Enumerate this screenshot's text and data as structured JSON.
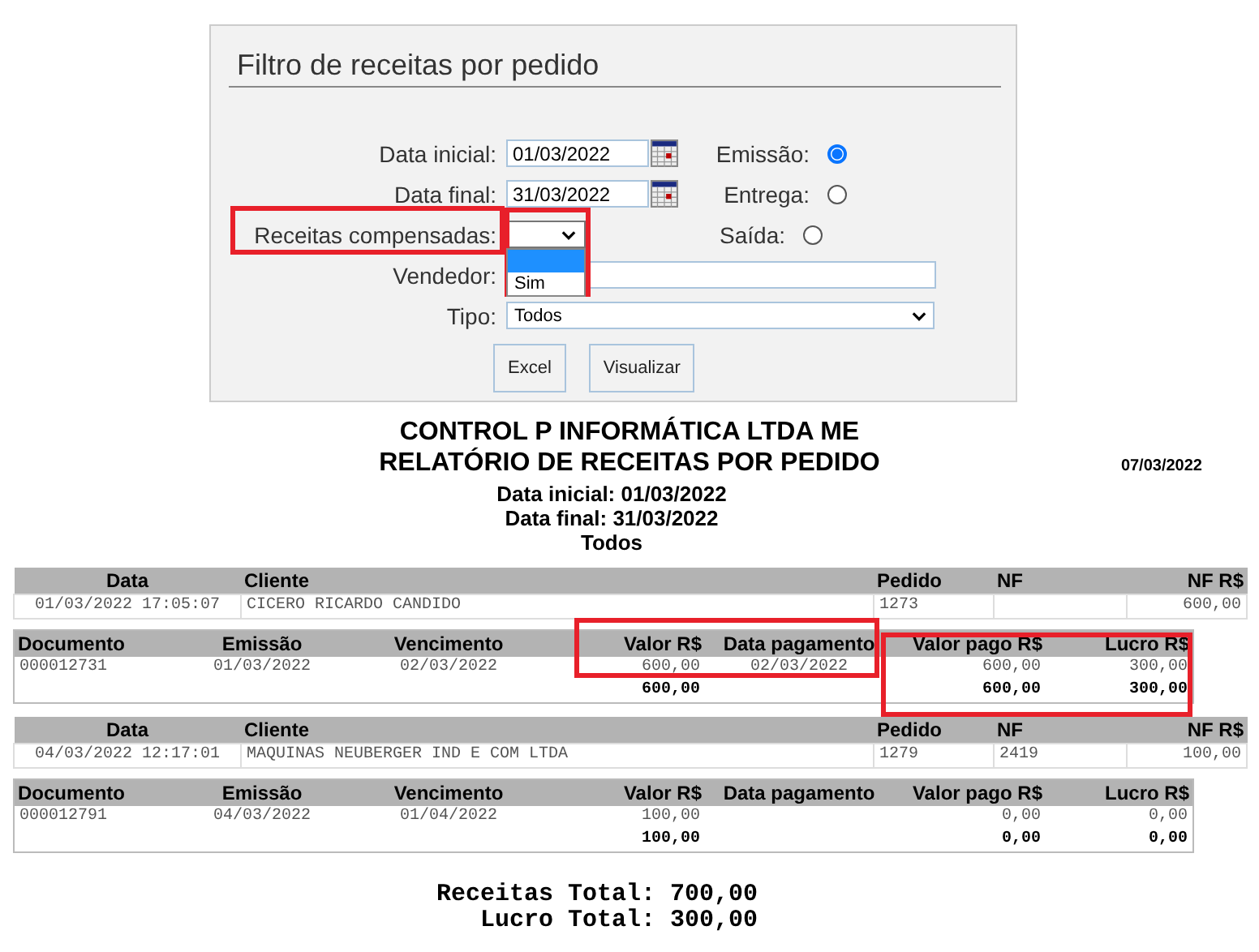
{
  "filter": {
    "title": "Filtro de receitas por pedido",
    "data_inicial": {
      "label": "Data inicial:",
      "value": "01/03/2022"
    },
    "data_final": {
      "label": "Data final:",
      "value": "31/03/2022"
    },
    "radios": [
      {
        "label": "Emissão:",
        "selected": true
      },
      {
        "label": "Entrega:",
        "selected": false
      },
      {
        "label": "Saída:",
        "selected": false
      }
    ],
    "compensadas": {
      "label": "Receitas compensadas:",
      "open": true,
      "blank_highlighted": true,
      "options": [
        {
          "label": "Sim",
          "selected": false
        }
      ]
    },
    "vendedor": {
      "label": "Vendedor:"
    },
    "tipo": {
      "label": "Tipo:",
      "value": "Todos"
    },
    "buttons": [
      "Excel",
      "Visualizar"
    ]
  },
  "report": {
    "company": "CONTROL P INFORMÁTICA LTDA ME",
    "title": "RELATÓRIO DE RECEITAS POR PEDIDO",
    "date": "07/03/2022",
    "subtitle": [
      "Data inicial: 01/03/2022",
      "Data final: 31/03/2022",
      "Todos"
    ],
    "groups": [
      {
        "order_columns": [
          "Data",
          "Cliente",
          "Pedido",
          "NF",
          "NF R$"
        ],
        "order": {
          "data": "01/03/2022 17:05:07",
          "cliente": "CICERO RICARDO CANDIDO",
          "pedido": "1273",
          "nf_valor": "600,00"
        },
        "receipt_columns": [
          "Documento",
          "Emissão",
          "Vencimento",
          "Valor R$",
          "Data pagamento",
          "Valor pago R$",
          "Lucro R$"
        ],
        "receipts": [
          {
            "documento": "000012731",
            "emissao": "01/03/2022",
            "vencimento": "02/03/2022",
            "valor": "600,00",
            "data_pagamento": "02/03/2022",
            "valor_pago": "600,00",
            "lucro": "300,00"
          }
        ],
        "totals": {
          "valor": "600,00",
          "valor_pago": "600,00",
          "lucro": "300,00"
        }
      },
      {
        "order_columns": [
          "Data",
          "Cliente",
          "Pedido",
          "NF",
          "NF R$"
        ],
        "order": {
          "data": "04/03/2022 12:17:01",
          "cliente": "MAQUINAS NEUBERGER IND E COM LTDA",
          "pedido": "1279",
          "nf": "2419",
          "nf_valor": "100,00"
        },
        "receipt_columns": [
          "Documento",
          "Emissão",
          "Vencimento",
          "Valor R$",
          "Data pagamento",
          "Valor pago R$",
          "Lucro R$"
        ],
        "receipts": [
          {
            "documento": "000012791",
            "emissao": "04/03/2022",
            "vencimento": "01/04/2022",
            "valor": "100,00",
            "valor_pago": "0,00",
            "lucro": "0,00"
          }
        ],
        "totals": {
          "valor": "100,00",
          "valor_pago": "0,00",
          "lucro": "0,00"
        }
      }
    ],
    "totals": [
      "Receitas Total: 700,00",
      "Lucro Total: 300,00"
    ]
  },
  "highlights": [
    {
      "kind": "box"
    },
    {
      "kind": "box"
    },
    {
      "kind": "box"
    },
    {
      "kind": "box"
    }
  ]
}
